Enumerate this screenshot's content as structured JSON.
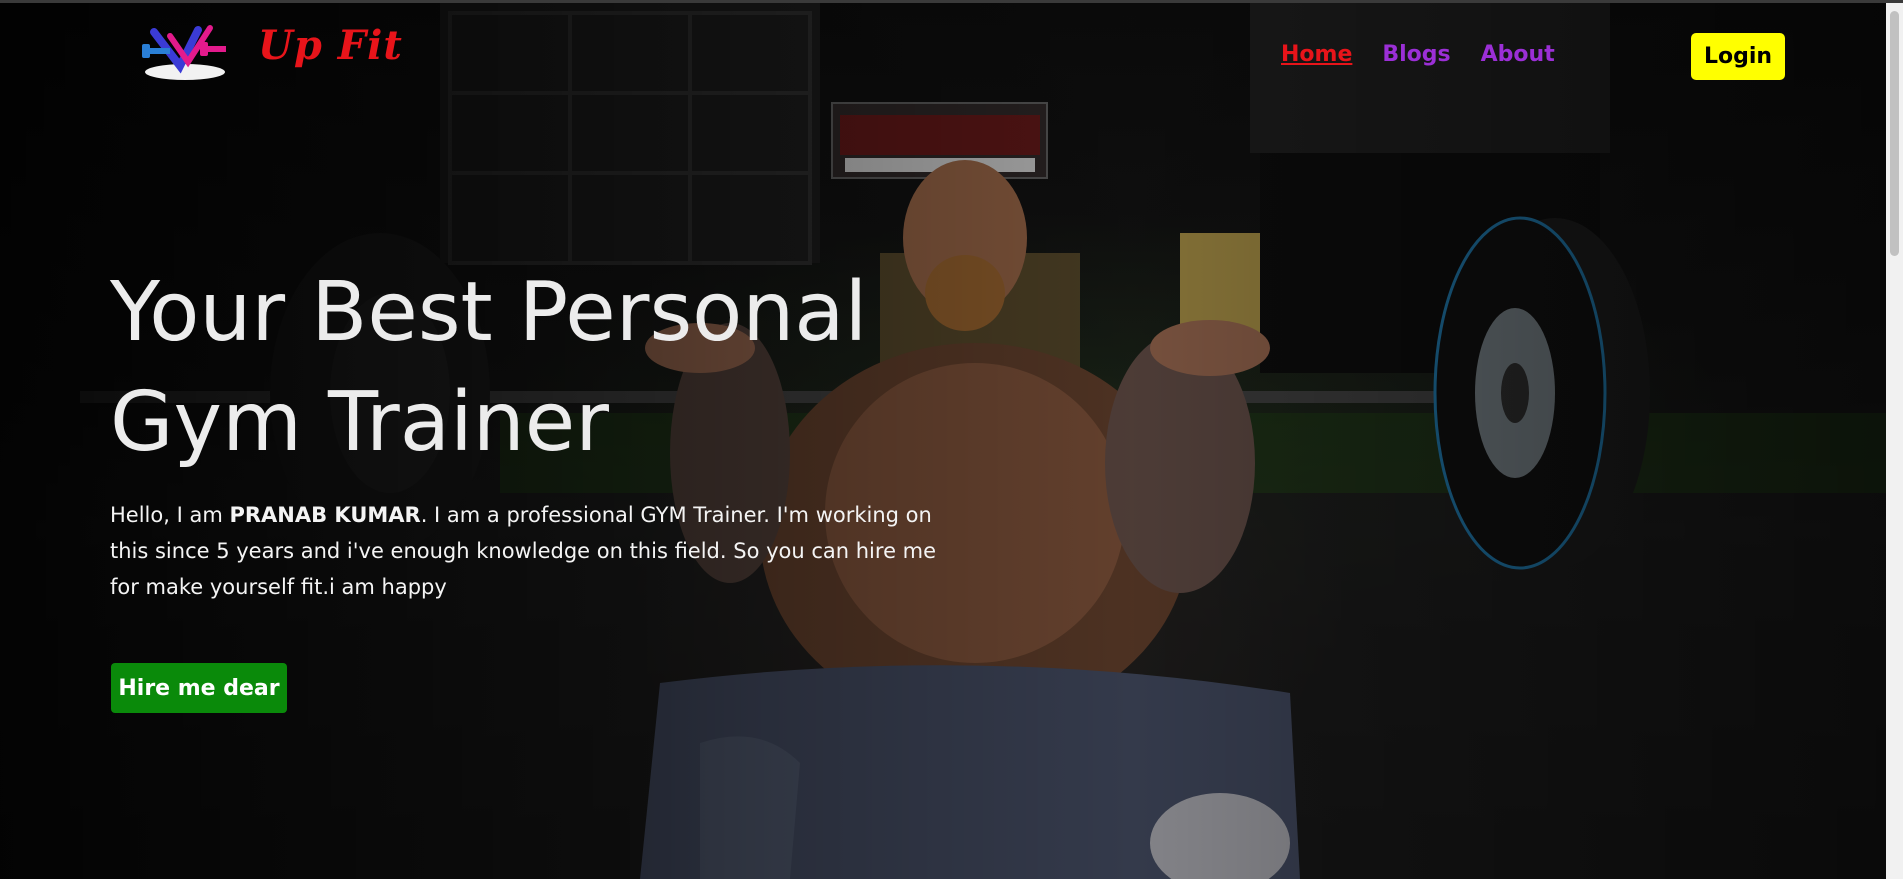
{
  "brand": {
    "name": "Up Fit",
    "logo_icon": "dumbbell-v-logo",
    "color": "#e8141a"
  },
  "nav": {
    "items": [
      {
        "label": "Home",
        "active": true
      },
      {
        "label": "Blogs",
        "active": false
      },
      {
        "label": "About",
        "active": false
      }
    ],
    "link_color": "#9b2fd6",
    "active_color": "#e8141a"
  },
  "login": {
    "label": "Login",
    "color": "#ffff00"
  },
  "hero": {
    "title_line1": "Your Best Personal",
    "title_line2": "Gym Trainer",
    "desc_prefix": "Hello, I am ",
    "desc_name": "PRANAB KUMAR",
    "desc_suffix": ". I am a professional GYM Trainer. I'm working on this since 5 years and i've enough knowledge on this field. So you can hire me for make yourself fit.i am happy",
    "cta_label": "Hire me dear",
    "cta_color": "#0a8a0a"
  }
}
